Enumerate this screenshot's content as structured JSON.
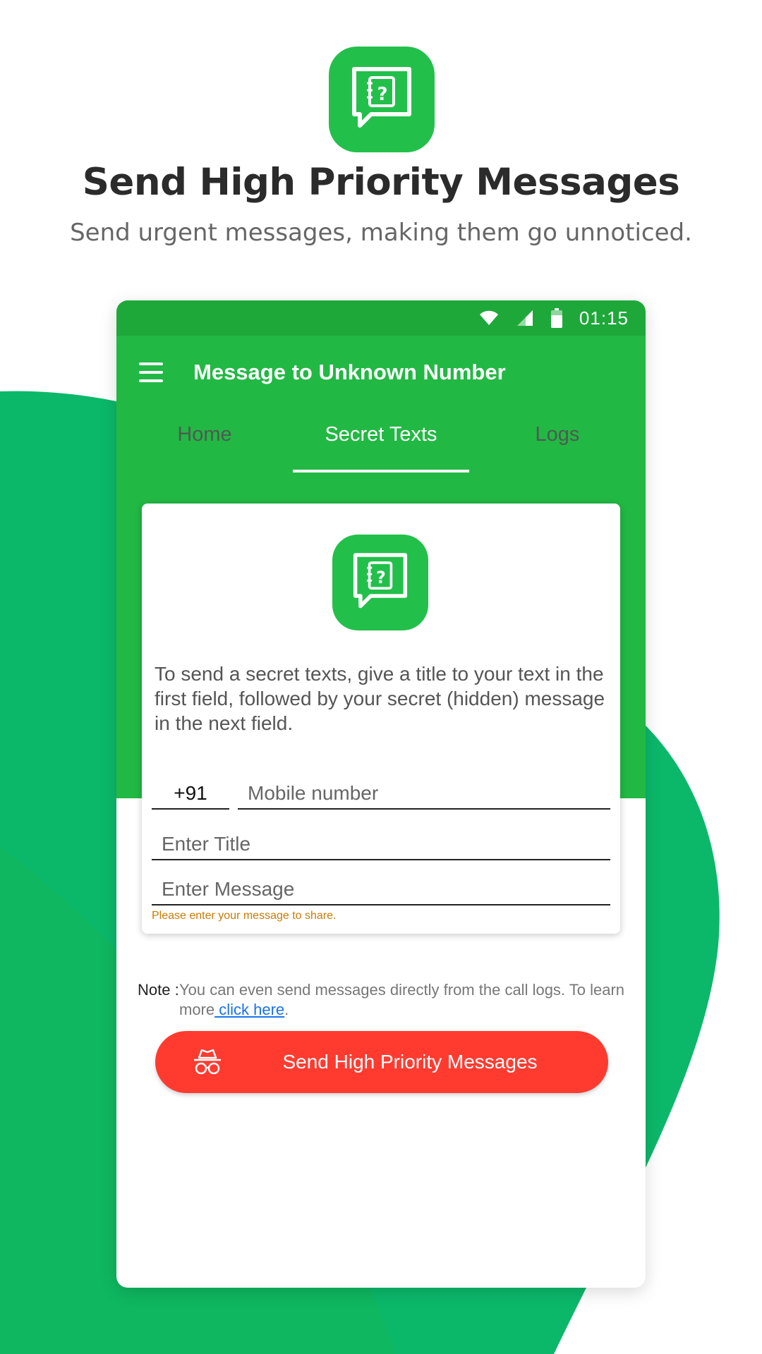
{
  "marketing": {
    "headline": "Send High Priority Messages",
    "subline": "Send urgent messages, making them go unnoticed."
  },
  "status_bar": {
    "time": "01:15"
  },
  "app_bar": {
    "title": "Message to Unknown Number"
  },
  "tabs": [
    {
      "label": "Home",
      "active": false
    },
    {
      "label": "Secret Texts",
      "active": true
    },
    {
      "label": "Logs",
      "active": false
    }
  ],
  "card": {
    "description": "To send a secret texts, give a title to your text in the first field, followed by your secret (hidden) message in the next field.",
    "country_code": "+91",
    "mobile_placeholder": "Mobile number",
    "title_placeholder": "Enter Title",
    "message_placeholder": "Enter Message",
    "error": "Please enter your message to share."
  },
  "note": {
    "label": "Note :",
    "text": "You can even send messages directly from the call logs. To learn more",
    "link": " click here",
    "suffix": "."
  },
  "cta": {
    "label": "Send High Priority Messages"
  },
  "colors": {
    "brand_green": "#22b844",
    "status_green": "#1fa83a",
    "accent_red": "#ff3b30",
    "bg_blob": "#0bb86a",
    "link": "#1a73e8",
    "error": "#c97b00"
  },
  "icons": [
    "secret-message-app-icon",
    "menu-icon",
    "wifi-icon",
    "signal-icon",
    "battery-icon",
    "incognito-icon"
  ]
}
